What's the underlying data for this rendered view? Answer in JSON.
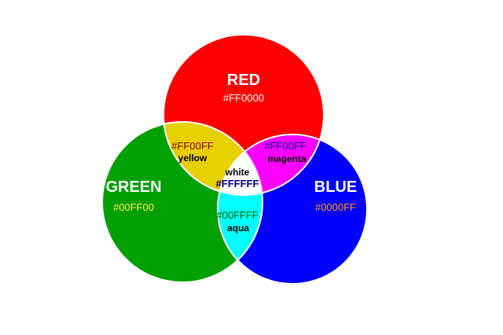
{
  "diagram": {
    "colors": {
      "red": "#ff0000",
      "green": "#00a000",
      "blue": "#0000ff",
      "yellow": "#e8d000",
      "magenta": "#ff00ff",
      "aqua": "#00ffff",
      "white": "#ffffff",
      "outline": "#ffffff"
    },
    "circles": {
      "red": {
        "name": "RED",
        "hex": "#FF0000"
      },
      "green": {
        "name": "GREEN",
        "hex": "#00FF00"
      },
      "blue": {
        "name": "BLUE",
        "hex": "#0000FF"
      }
    },
    "overlaps": {
      "yellow": {
        "hex": "#FF00FF",
        "name": "yellow"
      },
      "magenta": {
        "hex": "#FF00FF",
        "name": "magenta"
      },
      "aqua": {
        "hex": "#00FFFF",
        "name": "aqua"
      },
      "white": {
        "name": "white",
        "hex": "#FFFFFF"
      }
    }
  }
}
